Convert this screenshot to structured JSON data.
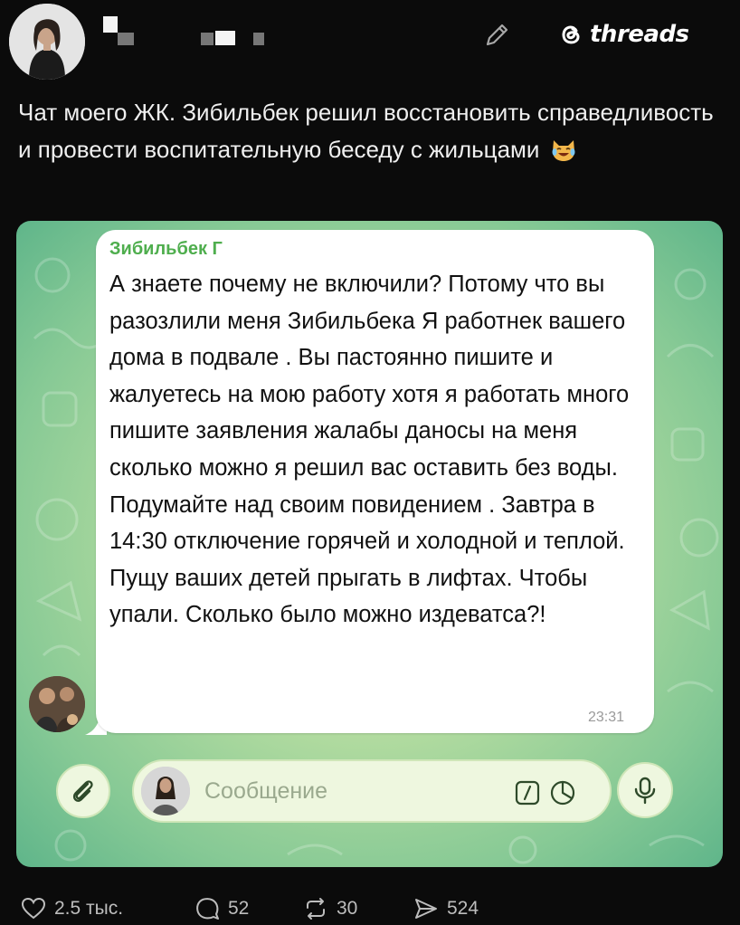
{
  "header": {
    "brand": "threads"
  },
  "post": {
    "caption": "Чат моего ЖК. Зибильбек решил восстановить справедливость и провести воспитательную беседу с жильцами",
    "caption_emoji": "crying-laughing-cat"
  },
  "chat": {
    "sender": "Зибильбек Г",
    "message": "А знаете почему не включили? Потому что вы разозлили меня Зибильбека Я работнек вашего дома в подвале . Вы пастоянно пишите и жалуетесь на мою работу хотя я работать много пишите заявления жалабы даносы на меня сколько можно я решил вас оставить без воды. Подумайте над своим повидением . Завтра в 14:30 отключение горячей и холодной и теплой. Пущу ваших детей прыгать в лифтах. Чтобы упали. Сколько было можно издеватса?!",
    "time": "23:31",
    "input_placeholder": "Сообщение"
  },
  "stats": {
    "likes": "2.5 тыс.",
    "comments": "52",
    "reposts": "30",
    "shares": "524"
  },
  "colors": {
    "background": "#0b0b0b",
    "sender_name": "#4fae4e",
    "chat_bg": "#b4dca0"
  }
}
